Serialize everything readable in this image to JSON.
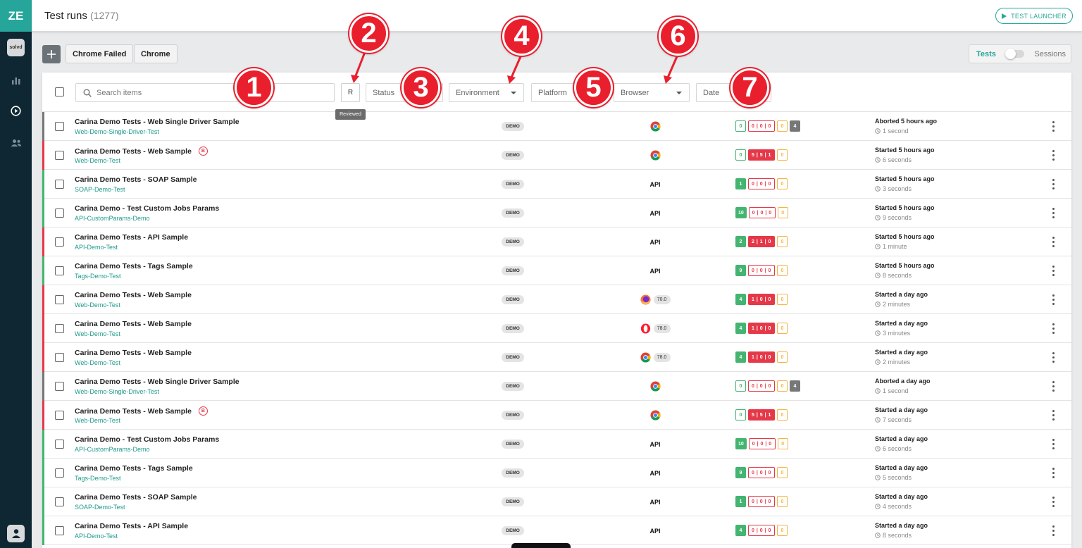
{
  "app": {
    "logo": "ZE",
    "org": "solvd"
  },
  "header": {
    "title": "Test runs",
    "count": "(1277)",
    "launcher_label": "TEST LAUNCHER"
  },
  "toolbar": {
    "chips": [
      "Chrome Failed",
      "Chrome"
    ],
    "toggle": {
      "left_label": "Tests",
      "right_label": "Sessions",
      "on": false
    }
  },
  "filters": {
    "search_placeholder": "Search items",
    "reviewed_short": "R",
    "reviewed_tooltip": "Reviewed",
    "status": "Status",
    "environment": "Environment",
    "platform": "Platform",
    "browser": "Browser",
    "date": "Date"
  },
  "callouts": [
    "1",
    "2",
    "3",
    "4",
    "5",
    "6",
    "7"
  ],
  "colors": {
    "teal": "#26a69a",
    "failed": "#e53848",
    "passed": "#43b570",
    "skipped": "#f3b53f",
    "aborted": "#777777",
    "callout": "#ea1f2d"
  },
  "rows": [
    {
      "name": "Carina Demo Tests - Web Single Driver Sample",
      "job": "Web-Demo-Single-Driver-Test",
      "bug": false,
      "env": "DEMO",
      "platform": {
        "kind": "browser",
        "icon": "chrome-icon",
        "version": ""
      },
      "stats": {
        "passed": "0",
        "passed_filled": false,
        "failed": "0 | 0 | 0",
        "failed_filled": false,
        "skipped": "0",
        "aborted": "4"
      },
      "status": "aborted",
      "when": "Aborted 5 hours ago",
      "duration": "1 second"
    },
    {
      "name": "Carina Demo Tests - Web Sample",
      "job": "Web-Demo-Test",
      "bug": true,
      "env": "DEMO",
      "platform": {
        "kind": "browser",
        "icon": "chrome-icon",
        "version": ""
      },
      "stats": {
        "passed": "0",
        "passed_filled": false,
        "failed": "5 | 5 | 1",
        "failed_filled": true,
        "skipped": "0",
        "aborted": ""
      },
      "status": "failed",
      "when": "Started 5 hours ago",
      "duration": "6 seconds"
    },
    {
      "name": "Carina Demo Tests - SOAP Sample",
      "job": "SOAP-Demo-Test",
      "bug": false,
      "env": "DEMO",
      "platform": {
        "kind": "api",
        "label": "API"
      },
      "stats": {
        "passed": "1",
        "passed_filled": true,
        "failed": "0 | 0 | 0",
        "failed_filled": false,
        "skipped": "0",
        "aborted": ""
      },
      "status": "passed",
      "when": "Started 5 hours ago",
      "duration": "3 seconds"
    },
    {
      "name": "Carina Demo - Test Custom Jobs Params",
      "job": "API-CustomParams-Demo",
      "bug": false,
      "env": "DEMO",
      "platform": {
        "kind": "api",
        "label": "API"
      },
      "stats": {
        "passed": "10",
        "passed_filled": true,
        "failed": "0 | 0 | 0",
        "failed_filled": false,
        "skipped": "0",
        "aborted": ""
      },
      "status": "passed",
      "when": "Started 5 hours ago",
      "duration": "9 seconds"
    },
    {
      "name": "Carina Demo Tests - API Sample",
      "job": "API-Demo-Test",
      "bug": false,
      "env": "DEMO",
      "platform": {
        "kind": "api",
        "label": "API"
      },
      "stats": {
        "passed": "2",
        "passed_filled": true,
        "failed": "2 | 1 | 0",
        "failed_filled": true,
        "skipped": "0",
        "aborted": ""
      },
      "status": "failed",
      "when": "Started 5 hours ago",
      "duration": "1 minute"
    },
    {
      "name": "Carina Demo Tests - Tags Sample",
      "job": "Tags-Demo-Test",
      "bug": false,
      "env": "DEMO",
      "platform": {
        "kind": "api",
        "label": "API"
      },
      "stats": {
        "passed": "9",
        "passed_filled": true,
        "failed": "0 | 0 | 0",
        "failed_filled": false,
        "skipped": "0",
        "aborted": ""
      },
      "status": "passed",
      "when": "Started 5 hours ago",
      "duration": "8 seconds"
    },
    {
      "name": "Carina Demo Tests - Web Sample",
      "job": "Web-Demo-Test",
      "bug": false,
      "env": "DEMO",
      "platform": {
        "kind": "browser",
        "icon": "firefox-icon",
        "version": "70.0"
      },
      "stats": {
        "passed": "4",
        "passed_filled": true,
        "failed": "1 | 0 | 0",
        "failed_filled": true,
        "skipped": "0",
        "aborted": ""
      },
      "status": "failed",
      "when": "Started a day ago",
      "duration": "2 minutes"
    },
    {
      "name": "Carina Demo Tests - Web Sample",
      "job": "Web-Demo-Test",
      "bug": false,
      "env": "DEMO",
      "platform": {
        "kind": "browser",
        "icon": "opera-icon",
        "version": "78.0"
      },
      "stats": {
        "passed": "4",
        "passed_filled": true,
        "failed": "1 | 0 | 0",
        "failed_filled": true,
        "skipped": "0",
        "aborted": ""
      },
      "status": "failed",
      "when": "Started a day ago",
      "duration": "3 minutes"
    },
    {
      "name": "Carina Demo Tests - Web Sample",
      "job": "Web-Demo-Test",
      "bug": false,
      "env": "DEMO",
      "platform": {
        "kind": "browser",
        "icon": "chrome-icon",
        "version": "78.0"
      },
      "stats": {
        "passed": "4",
        "passed_filled": true,
        "failed": "1 | 0 | 0",
        "failed_filled": true,
        "skipped": "0",
        "aborted": ""
      },
      "status": "failed",
      "when": "Started a day ago",
      "duration": "2 minutes"
    },
    {
      "name": "Carina Demo Tests - Web Single Driver Sample",
      "job": "Web-Demo-Single-Driver-Test",
      "bug": false,
      "env": "DEMO",
      "platform": {
        "kind": "browser",
        "icon": "chrome-icon",
        "version": ""
      },
      "stats": {
        "passed": "0",
        "passed_filled": false,
        "failed": "0 | 0 | 0",
        "failed_filled": false,
        "skipped": "0",
        "aborted": "4"
      },
      "status": "aborted",
      "when": "Aborted a day ago",
      "duration": "1 second"
    },
    {
      "name": "Carina Demo Tests - Web Sample",
      "job": "Web-Demo-Test",
      "bug": true,
      "env": "DEMO",
      "platform": {
        "kind": "browser",
        "icon": "chrome-icon",
        "version": ""
      },
      "stats": {
        "passed": "0",
        "passed_filled": false,
        "failed": "5 | 5 | 1",
        "failed_filled": true,
        "skipped": "0",
        "aborted": ""
      },
      "status": "failed",
      "when": "Started a day ago",
      "duration": "7 seconds"
    },
    {
      "name": "Carina Demo - Test Custom Jobs Params",
      "job": "API-CustomParams-Demo",
      "bug": false,
      "env": "DEMO",
      "platform": {
        "kind": "api",
        "label": "API"
      },
      "stats": {
        "passed": "10",
        "passed_filled": true,
        "failed": "0 | 0 | 0",
        "failed_filled": false,
        "skipped": "0",
        "aborted": ""
      },
      "status": "passed",
      "when": "Started a day ago",
      "duration": "6 seconds"
    },
    {
      "name": "Carina Demo Tests - Tags Sample",
      "job": "Tags-Demo-Test",
      "bug": false,
      "env": "DEMO",
      "platform": {
        "kind": "api",
        "label": "API"
      },
      "stats": {
        "passed": "9",
        "passed_filled": true,
        "failed": "0 | 0 | 0",
        "failed_filled": false,
        "skipped": "0",
        "aborted": ""
      },
      "status": "passed",
      "when": "Started a day ago",
      "duration": "5 seconds"
    },
    {
      "name": "Carina Demo Tests - SOAP Sample",
      "job": "SOAP-Demo-Test",
      "bug": false,
      "env": "DEMO",
      "platform": {
        "kind": "api",
        "label": "API"
      },
      "stats": {
        "passed": "1",
        "passed_filled": true,
        "failed": "0 | 0 | 0",
        "failed_filled": false,
        "skipped": "0",
        "aborted": ""
      },
      "status": "passed",
      "when": "Started a day ago",
      "duration": "4 seconds"
    },
    {
      "name": "Carina Demo Tests - API Sample",
      "job": "API-Demo-Test",
      "bug": false,
      "env": "DEMO",
      "platform": {
        "kind": "api",
        "label": "API"
      },
      "stats": {
        "passed": "4",
        "passed_filled": true,
        "failed": "0 | 0 | 0",
        "failed_filled": false,
        "skipped": "0",
        "aborted": ""
      },
      "status": "passed",
      "when": "Started a day ago",
      "duration": "8 seconds"
    }
  ]
}
